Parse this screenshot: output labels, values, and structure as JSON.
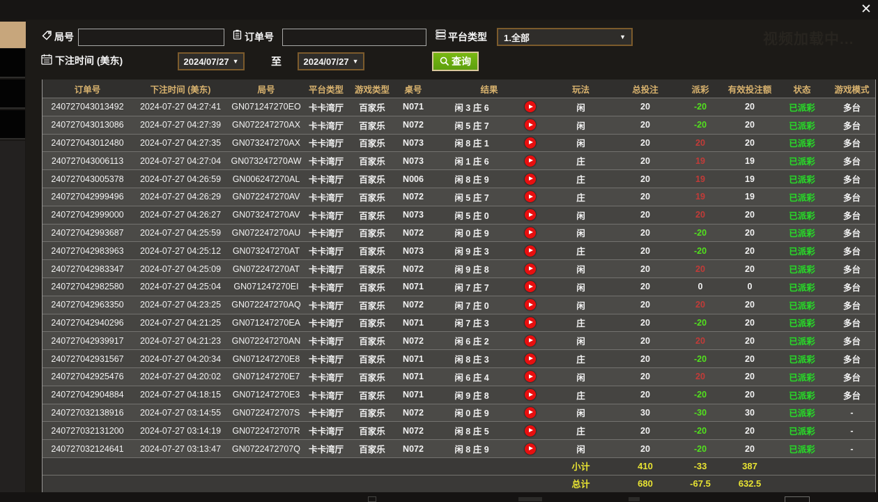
{
  "titlebar": {
    "close_label": "✕"
  },
  "background": {
    "video_loading_text": "视频加载中..."
  },
  "filters": {
    "round_label": "局号",
    "round_value": "",
    "order_label": "订单号",
    "order_value": "",
    "platform_label": "平台类型",
    "platform_value": "1.全部",
    "bet_time_label": "下注时间 (美东)",
    "date_from": "2024/07/27",
    "to_label": "至",
    "date_to": "2024/07/27",
    "query_label": "查询",
    "dropdown_arrow": "▼"
  },
  "table": {
    "headers": [
      {
        "label": "订单号",
        "span": 1
      },
      {
        "label": "下注时间 (美东)",
        "span": 1
      },
      {
        "label": "局号",
        "span": 1
      },
      {
        "label": "平台类型",
        "span": 1
      },
      {
        "label": "游戏类型",
        "span": 1
      },
      {
        "label": "桌号",
        "span": 1
      },
      {
        "label": "结果",
        "span": 2
      },
      {
        "label": "玩法",
        "span": 1
      },
      {
        "label": "总投注",
        "span": 1
      },
      {
        "label": "派彩",
        "span": 1
      },
      {
        "label": "有效投注额",
        "span": 1
      },
      {
        "label": "状态",
        "span": 1
      },
      {
        "label": "游戏模式",
        "span": 1
      }
    ],
    "rows": [
      {
        "order_no": "240727043013492",
        "bet_time": "2024-07-27 04:27:41",
        "round_no": "GN071247270EO",
        "platform": "卡卡湾厅",
        "game_type": "百家乐",
        "table_no": "N071",
        "result": "闲 3 庄 6",
        "play": "闲",
        "total_bet": "20",
        "payout": "-20",
        "valid_bet": "20",
        "status": "已派彩",
        "game_mode": "多台"
      },
      {
        "order_no": "240727043013086",
        "bet_time": "2024-07-27 04:27:39",
        "round_no": "GN072247270AX",
        "platform": "卡卡湾厅",
        "game_type": "百家乐",
        "table_no": "N072",
        "result": "闲 5 庄 7",
        "play": "闲",
        "total_bet": "20",
        "payout": "-20",
        "valid_bet": "20",
        "status": "已派彩",
        "game_mode": "多台"
      },
      {
        "order_no": "240727043012480",
        "bet_time": "2024-07-27 04:27:35",
        "round_no": "GN073247270AX",
        "platform": "卡卡湾厅",
        "game_type": "百家乐",
        "table_no": "N073",
        "result": "闲 8 庄 1",
        "play": "闲",
        "total_bet": "20",
        "payout": "20",
        "valid_bet": "20",
        "status": "已派彩",
        "game_mode": "多台"
      },
      {
        "order_no": "240727043006113",
        "bet_time": "2024-07-27 04:27:04",
        "round_no": "GN073247270AW",
        "platform": "卡卡湾厅",
        "game_type": "百家乐",
        "table_no": "N073",
        "result": "闲 1 庄 6",
        "play": "庄",
        "total_bet": "20",
        "payout": "19",
        "valid_bet": "19",
        "status": "已派彩",
        "game_mode": "多台"
      },
      {
        "order_no": "240727043005378",
        "bet_time": "2024-07-27 04:26:59",
        "round_no": "GN006247270AL",
        "platform": "卡卡湾厅",
        "game_type": "百家乐",
        "table_no": "N006",
        "result": "闲 8 庄 9",
        "play": "庄",
        "total_bet": "20",
        "payout": "19",
        "valid_bet": "19",
        "status": "已派彩",
        "game_mode": "多台"
      },
      {
        "order_no": "240727042999496",
        "bet_time": "2024-07-27 04:26:29",
        "round_no": "GN072247270AV",
        "platform": "卡卡湾厅",
        "game_type": "百家乐",
        "table_no": "N072",
        "result": "闲 5 庄 7",
        "play": "庄",
        "total_bet": "20",
        "payout": "19",
        "valid_bet": "19",
        "status": "已派彩",
        "game_mode": "多台"
      },
      {
        "order_no": "240727042999000",
        "bet_time": "2024-07-27 04:26:27",
        "round_no": "GN073247270AV",
        "platform": "卡卡湾厅",
        "game_type": "百家乐",
        "table_no": "N073",
        "result": "闲 5 庄 0",
        "play": "闲",
        "total_bet": "20",
        "payout": "20",
        "valid_bet": "20",
        "status": "已派彩",
        "game_mode": "多台"
      },
      {
        "order_no": "240727042993687",
        "bet_time": "2024-07-27 04:25:59",
        "round_no": "GN072247270AU",
        "platform": "卡卡湾厅",
        "game_type": "百家乐",
        "table_no": "N072",
        "result": "闲 0 庄 9",
        "play": "闲",
        "total_bet": "20",
        "payout": "-20",
        "valid_bet": "20",
        "status": "已派彩",
        "game_mode": "多台"
      },
      {
        "order_no": "240727042983963",
        "bet_time": "2024-07-27 04:25:12",
        "round_no": "GN073247270AT",
        "platform": "卡卡湾厅",
        "game_type": "百家乐",
        "table_no": "N073",
        "result": "闲 9 庄 3",
        "play": "庄",
        "total_bet": "20",
        "payout": "-20",
        "valid_bet": "20",
        "status": "已派彩",
        "game_mode": "多台"
      },
      {
        "order_no": "240727042983347",
        "bet_time": "2024-07-27 04:25:09",
        "round_no": "GN072247270AT",
        "platform": "卡卡湾厅",
        "game_type": "百家乐",
        "table_no": "N072",
        "result": "闲 9 庄 8",
        "play": "闲",
        "total_bet": "20",
        "payout": "20",
        "valid_bet": "20",
        "status": "已派彩",
        "game_mode": "多台"
      },
      {
        "order_no": "240727042982580",
        "bet_time": "2024-07-27 04:25:04",
        "round_no": "GN071247270EI",
        "platform": "卡卡湾厅",
        "game_type": "百家乐",
        "table_no": "N071",
        "result": "闲 7 庄 7",
        "play": "闲",
        "total_bet": "20",
        "payout": "0",
        "valid_bet": "0",
        "status": "已派彩",
        "game_mode": "多台"
      },
      {
        "order_no": "240727042963350",
        "bet_time": "2024-07-27 04:23:25",
        "round_no": "GN072247270AQ",
        "platform": "卡卡湾厅",
        "game_type": "百家乐",
        "table_no": "N072",
        "result": "闲 7 庄 0",
        "play": "闲",
        "total_bet": "20",
        "payout": "20",
        "valid_bet": "20",
        "status": "已派彩",
        "game_mode": "多台"
      },
      {
        "order_no": "240727042940296",
        "bet_time": "2024-07-27 04:21:25",
        "round_no": "GN071247270EA",
        "platform": "卡卡湾厅",
        "game_type": "百家乐",
        "table_no": "N071",
        "result": "闲 7 庄 3",
        "play": "庄",
        "total_bet": "20",
        "payout": "-20",
        "valid_bet": "20",
        "status": "已派彩",
        "game_mode": "多台"
      },
      {
        "order_no": "240727042939917",
        "bet_time": "2024-07-27 04:21:23",
        "round_no": "GN072247270AN",
        "platform": "卡卡湾厅",
        "game_type": "百家乐",
        "table_no": "N072",
        "result": "闲 6 庄 2",
        "play": "闲",
        "total_bet": "20",
        "payout": "20",
        "valid_bet": "20",
        "status": "已派彩",
        "game_mode": "多台"
      },
      {
        "order_no": "240727042931567",
        "bet_time": "2024-07-27 04:20:34",
        "round_no": "GN071247270E8",
        "platform": "卡卡湾厅",
        "game_type": "百家乐",
        "table_no": "N071",
        "result": "闲 8 庄 3",
        "play": "庄",
        "total_bet": "20",
        "payout": "-20",
        "valid_bet": "20",
        "status": "已派彩",
        "game_mode": "多台"
      },
      {
        "order_no": "240727042925476",
        "bet_time": "2024-07-27 04:20:02",
        "round_no": "GN071247270E7",
        "platform": "卡卡湾厅",
        "game_type": "百家乐",
        "table_no": "N071",
        "result": "闲 6 庄 4",
        "play": "闲",
        "total_bet": "20",
        "payout": "20",
        "valid_bet": "20",
        "status": "已派彩",
        "game_mode": "多台"
      },
      {
        "order_no": "240727042904884",
        "bet_time": "2024-07-27 04:18:15",
        "round_no": "GN071247270E3",
        "platform": "卡卡湾厅",
        "game_type": "百家乐",
        "table_no": "N071",
        "result": "闲 9 庄 8",
        "play": "庄",
        "total_bet": "20",
        "payout": "-20",
        "valid_bet": "20",
        "status": "已派彩",
        "game_mode": "多台"
      },
      {
        "order_no": "240727032138916",
        "bet_time": "2024-07-27 03:14:55",
        "round_no": "GN0722472707S",
        "platform": "卡卡湾厅",
        "game_type": "百家乐",
        "table_no": "N072",
        "result": "闲 0 庄 9",
        "play": "闲",
        "total_bet": "30",
        "payout": "-30",
        "valid_bet": "30",
        "status": "已派彩",
        "game_mode": "-"
      },
      {
        "order_no": "240727032131200",
        "bet_time": "2024-07-27 03:14:19",
        "round_no": "GN0722472707R",
        "platform": "卡卡湾厅",
        "game_type": "百家乐",
        "table_no": "N072",
        "result": "闲 8 庄 5",
        "play": "庄",
        "total_bet": "20",
        "payout": "-20",
        "valid_bet": "20",
        "status": "已派彩",
        "game_mode": "-"
      },
      {
        "order_no": "240727032124641",
        "bet_time": "2024-07-27 03:13:47",
        "round_no": "GN0722472707Q",
        "platform": "卡卡湾厅",
        "game_type": "百家乐",
        "table_no": "N072",
        "result": "闲 8 庄 9",
        "play": "闲",
        "total_bet": "20",
        "payout": "-20",
        "valid_bet": "20",
        "status": "已派彩",
        "game_mode": "-"
      }
    ],
    "subtotal": {
      "label": "小计",
      "total_bet": "410",
      "payout": "-33",
      "valid_bet": "387"
    },
    "total": {
      "label": "总计",
      "total_bet": "680",
      "payout": "-67.5",
      "valid_bet": "632.5"
    }
  },
  "colors": {
    "header_gold": "#d8b26e",
    "payout_positive_red": "#c23b38",
    "payout_negative_green": "#52e11e",
    "status_paid_green": "#2ed42e",
    "summary_yellow": "#e8e332",
    "query_button_green": "#6aae10",
    "active_tab_tan": "#c7a67c",
    "play_icon_red": "#e80f0f"
  }
}
